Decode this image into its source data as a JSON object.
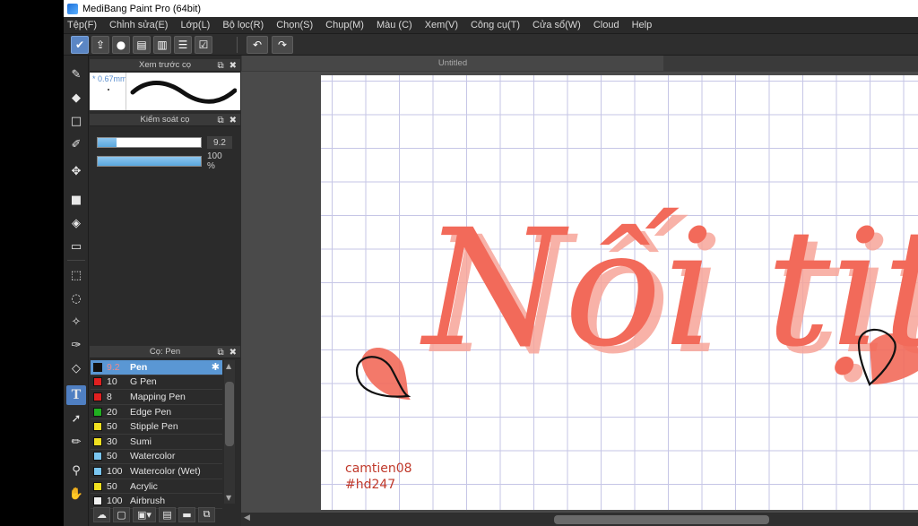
{
  "window": {
    "title": "MediBang Paint Pro (64bit)"
  },
  "menu": [
    "Tệp(F)",
    "Chỉnh sửa(E)",
    "Lớp(L)",
    "Bộ lọc(R)",
    "Chọn(S)",
    "Chụp(M)",
    "Màu (C)",
    "Xem(V)",
    "Công cụ(T)",
    "Cửa sổ(W)",
    "Cloud",
    "Help"
  ],
  "toolbar": {
    "buttons": [
      "check-icon",
      "share-icon",
      "speech-bubble-icon",
      "comment-icon",
      "page-icon",
      "list-icon",
      "checklist-icon"
    ],
    "undo_icon": "undo-icon",
    "redo_icon": "redo-icon"
  },
  "tools": [
    "brush-icon",
    "eraser-icon",
    "dot-icon",
    "blend-icon",
    "move-icon",
    "fill-rect-icon",
    "bucket-icon",
    "gradient-icon",
    "select-rect-icon",
    "select-lasso-icon",
    "magic-wand-icon",
    "select-pen-icon",
    "select-eraser-icon",
    "text-icon",
    "operation-icon",
    "dropper-icon",
    "hand-icon"
  ],
  "preview_panel": {
    "title": "Xem trước cọ",
    "size": "* 0.67mm"
  },
  "control_panel": {
    "title": "Kiểm soát cọ",
    "size_value": "9.2",
    "size_fill": 0.18,
    "opacity_value": "100 %",
    "opacity_fill": 1.0
  },
  "brush_panel": {
    "title": "Cọ: Pen",
    "brushes": [
      {
        "size": "9.2",
        "name": "Pen",
        "color": "#111111",
        "selected": true
      },
      {
        "size": "10",
        "name": "G Pen",
        "color": "#e02020",
        "selected": false
      },
      {
        "size": "8",
        "name": "Mapping Pen",
        "color": "#e02020",
        "selected": false
      },
      {
        "size": "20",
        "name": "Edge Pen",
        "color": "#20b020",
        "selected": false
      },
      {
        "size": "50",
        "name": "Stipple Pen",
        "color": "#f0e020",
        "selected": false
      },
      {
        "size": "30",
        "name": "Sumi",
        "color": "#f0e020",
        "selected": false
      },
      {
        "size": "50",
        "name": "Watercolor",
        "color": "#7ac6f0",
        "selected": false
      },
      {
        "size": "100",
        "name": "Watercolor (Wet)",
        "color": "#7ac6f0",
        "selected": false
      },
      {
        "size": "50",
        "name": "Acrylic",
        "color": "#f0e020",
        "selected": false
      },
      {
        "size": "100",
        "name": "Airbrush",
        "color": "#f0f0f0",
        "selected": false
      }
    ]
  },
  "document": {
    "tab_title": "Untitled",
    "lettering": "Nối tịt",
    "watermark_line1": "camtien08",
    "watermark_line2": "#hd247",
    "lettering_color": "#f26a5a"
  }
}
